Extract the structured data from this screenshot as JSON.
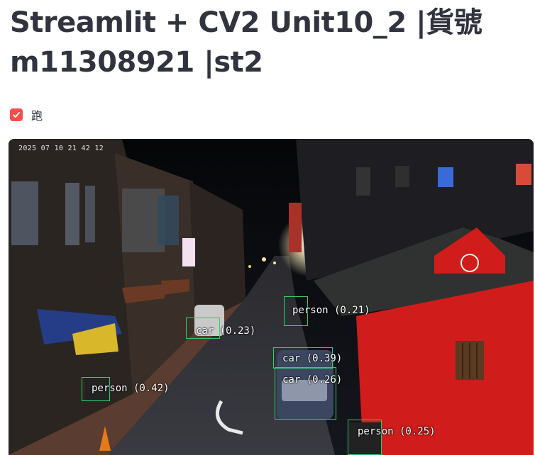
{
  "page": {
    "title": "Streamlit + CV2 Unit10_2 |貨號 m11308921 |st2"
  },
  "checkbox": {
    "label": "跑",
    "checked": true,
    "accent_color": "#ff4b4b"
  },
  "video": {
    "timestamp": "2025 07 10 21 42 12",
    "box_color": "#2fd06a",
    "detections": [
      {
        "label": "person (0.21)"
      },
      {
        "label": "car (0.23)"
      },
      {
        "label": "car (0.39)"
      },
      {
        "label": "car (0.26)"
      },
      {
        "label": "person (0.42)"
      },
      {
        "label": "person (0.25)"
      }
    ]
  }
}
